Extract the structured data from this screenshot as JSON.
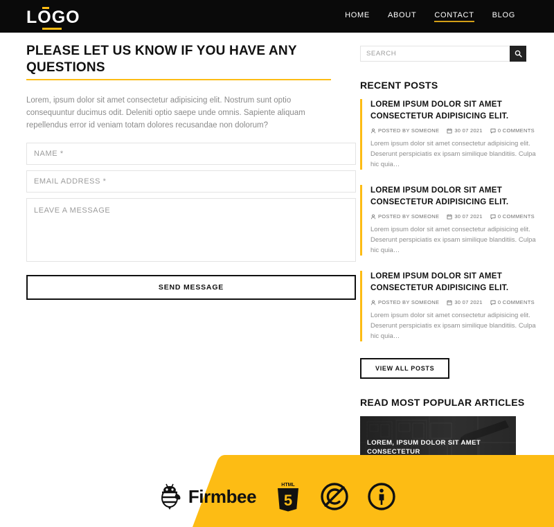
{
  "header": {
    "logo": "LOGO",
    "nav": [
      {
        "label": "HOME",
        "active": false
      },
      {
        "label": "ABOUT",
        "active": false
      },
      {
        "label": "CONTACT",
        "active": true
      },
      {
        "label": "BLOG",
        "active": false
      }
    ]
  },
  "main": {
    "title": "PLEASE LET US KNOW IF YOU HAVE ANY QUESTIONS",
    "intro": "Lorem, ipsum dolor sit amet consectetur adipisicing elit. Nostrum sunt optio consequuntur ducimus odit. Deleniti optio saepe unde omnis. Sapiente aliquam repellendus error id veniam totam dolores recusandae non dolorum?",
    "form": {
      "name_placeholder": "NAME *",
      "name_value": "",
      "email_placeholder": "EMAIL ADDRESS *",
      "email_value": "",
      "message_placeholder": "LEAVE A MESSAGE",
      "message_value": "",
      "submit_label": "SEND MESSAGE"
    }
  },
  "sidebar": {
    "search": {
      "placeholder": "SEARCH",
      "value": "",
      "icon": "search-icon"
    },
    "recent_posts_heading": "RECENT POSTS",
    "posts": [
      {
        "title": "LOREM IPSUM DOLOR SIT AMET CONSECTETUR ADIPISICING ELIT.",
        "author": "POSTED BY SOMEONE",
        "date": "30 07 2021",
        "comments": "0 COMMENTS",
        "excerpt": "Lorem ipsum dolor sit amet consectetur adipisicing elit. Deserunt perspiciatis ex ipsam similique blanditiis. Culpa hic quia…"
      },
      {
        "title": "LOREM IPSUM DOLOR SIT AMET CONSECTETUR ADIPISICING ELIT.",
        "author": "POSTED BY SOMEONE",
        "date": "30 07 2021",
        "comments": "0 COMMENTS",
        "excerpt": "Lorem ipsum dolor sit amet consectetur adipisicing elit. Deserunt perspiciatis ex ipsam similique blanditiis. Culpa hic quia…"
      },
      {
        "title": "LOREM IPSUM DOLOR SIT AMET CONSECTETUR ADIPISICING ELIT.",
        "author": "POSTED BY SOMEONE",
        "date": "30 07 2021",
        "comments": "0 COMMENTS",
        "excerpt": "Lorem ipsum dolor sit amet consectetur adipisicing elit. Deserunt perspiciatis ex ipsam similique blanditiis. Culpa hic quia…"
      }
    ],
    "view_all_label": "VIEW ALL POSTS",
    "popular_heading": "READ MOST POPULAR ARTICLES",
    "featured_article": {
      "title": "LOREM, IPSUM DOLOR SIT AMET CONSECTETUR"
    }
  },
  "footer": {
    "brand_name": "Firmbee",
    "icons": [
      "firmbee-bee-icon",
      "html5-icon",
      "copyright-crossed-icon",
      "person-circle-icon"
    ]
  },
  "icons": {
    "author": "person-icon",
    "date": "calendar-icon",
    "comments": "comment-icon"
  },
  "colors": {
    "accent": "#fdbc14",
    "header_bg": "#0a0a0a",
    "text": "#111111",
    "muted": "#8d8d8d"
  }
}
